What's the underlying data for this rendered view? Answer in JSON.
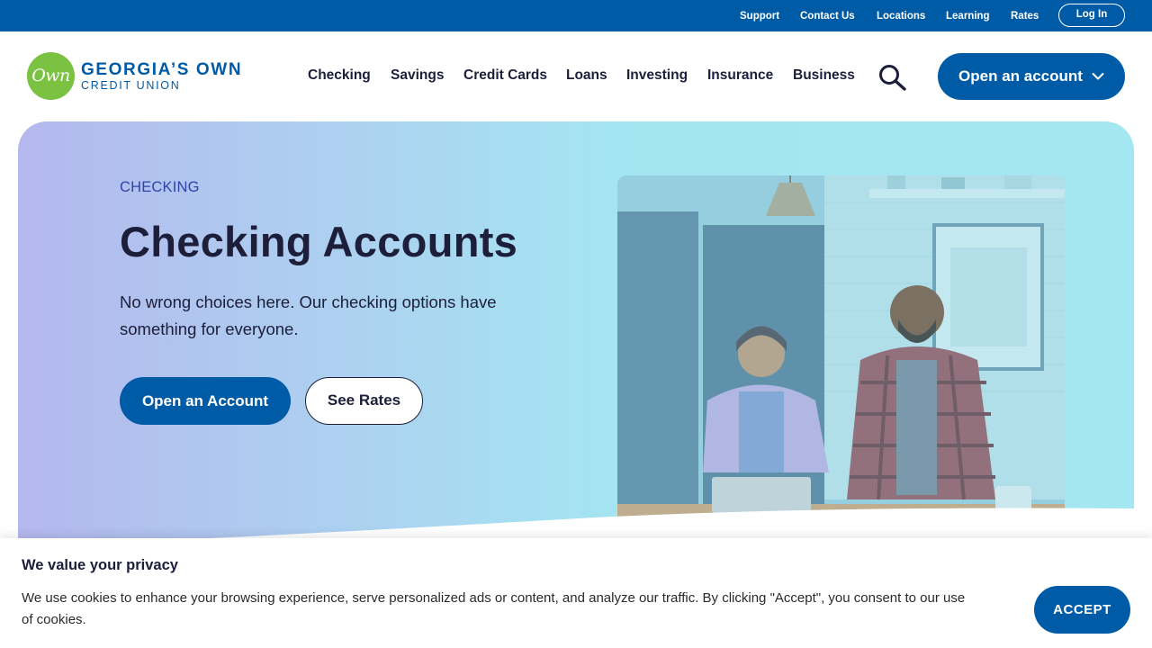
{
  "utility_nav": {
    "links": [
      "Support",
      "Contact Us",
      "Locations",
      "Learning",
      "Rates"
    ],
    "login_label": "Log In"
  },
  "brand": {
    "logo_mark": "Own",
    "name_line1": "GEORGIA’S OWN",
    "name_line2": "CREDIT UNION",
    "brand_blue": "#005ba6",
    "logo_green": "#7cc242"
  },
  "main_nav": {
    "items": [
      "Checking",
      "Savings",
      "Credit Cards",
      "Loans",
      "Investing",
      "Insurance",
      "Business"
    ],
    "search_icon": "search-icon",
    "open_account_label": "Open an account",
    "open_account_icon": "chevron-down-icon"
  },
  "hero": {
    "eyebrow": "CHECKING",
    "title": "Checking Accounts",
    "subtitle": "No wrong choices here. Our checking options have something for everyone.",
    "primary_cta": "Open an Account",
    "secondary_cta": "See Rates"
  },
  "cookie_banner": {
    "title": "We value your privacy",
    "text": "We use cookies to enhance your browsing experience, serve personalized ads or content, and analyze our traffic. By clicking \"Accept\", you consent to our use of cookies.",
    "accept_label": "ACCEPT"
  }
}
